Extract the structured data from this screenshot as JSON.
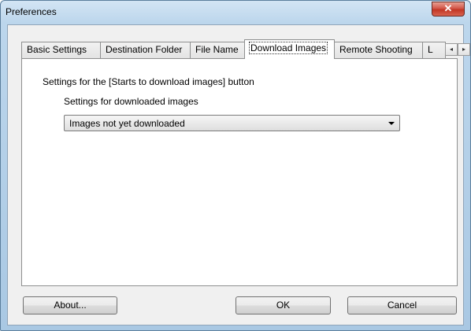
{
  "window": {
    "title": "Preferences",
    "close_glyph": "✕"
  },
  "tabs": [
    {
      "label": "Basic Settings"
    },
    {
      "label": "Destination Folder"
    },
    {
      "label": "File Name"
    },
    {
      "label": "Download Images",
      "active": true
    },
    {
      "label": "Remote Shooting"
    },
    {
      "label": "L"
    }
  ],
  "tab_scroll": {
    "left_glyph": "◂",
    "right_glyph": "▸"
  },
  "panel": {
    "section_label": "Settings for the [Starts to download images] button",
    "sub_label": "Settings for downloaded images",
    "dropdown_value": "Images not yet downloaded"
  },
  "buttons": {
    "about": "About...",
    "ok": "OK",
    "cancel": "Cancel"
  }
}
